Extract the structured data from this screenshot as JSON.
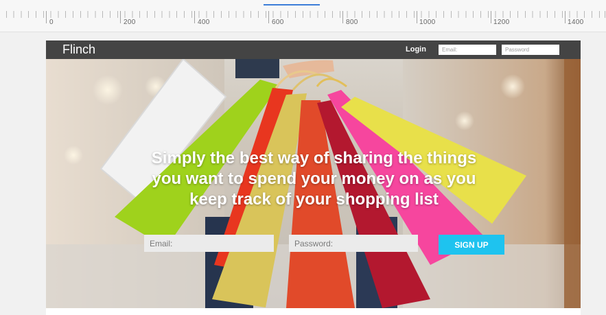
{
  "ruler": {
    "labels": [
      "0",
      "200",
      "400",
      "600",
      "800",
      "1000",
      "1200",
      "1400"
    ]
  },
  "nav": {
    "brand": "Flinch",
    "login_label": "Login",
    "email_placeholder": "Email:",
    "password_placeholder": "Password"
  },
  "hero": {
    "headline": "Simply the best way of sharing the things\nyou want to spend your money on as you\nkeep track of your shopping list",
    "email_placeholder": "Email:",
    "password_placeholder": "Password:",
    "signup_label": "SIGN UP"
  },
  "colors": {
    "nav_bg": "#444444",
    "accent": "#1ec3ef",
    "bag_colors": [
      "#ffffff",
      "#9fd21c",
      "#e8361f",
      "#d9c45a",
      "#e14a2a",
      "#b3182f",
      "#f6469e",
      "#e8e04a"
    ]
  }
}
